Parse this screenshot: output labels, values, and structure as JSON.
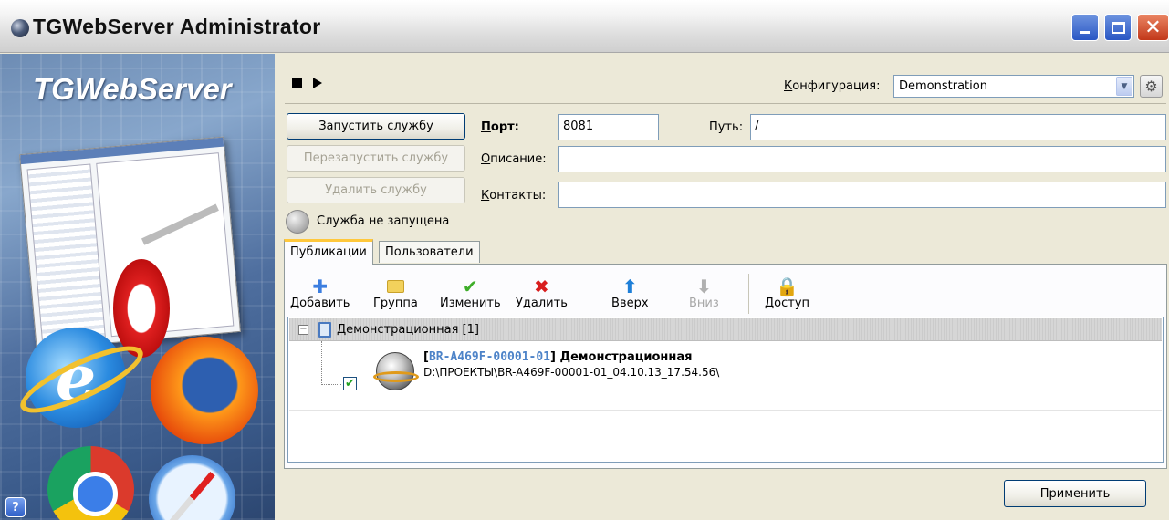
{
  "window": {
    "title": "TGWebServer Administrator"
  },
  "sidebar": {
    "brand": "TGWebServer",
    "help": "?"
  },
  "toolbar_top": {
    "config_label": "Конфигурация:",
    "config_value": "Demonstration"
  },
  "service": {
    "start_label": "Запустить службу",
    "restart_label": "Перезапустить службу",
    "delete_label": "Удалить службу",
    "status_text": "Служба не запущена"
  },
  "settings": {
    "port_label": "Порт:",
    "port_value": "8081",
    "path_label": "Путь:",
    "path_value": "/",
    "description_label": "Описание:",
    "description_value": "",
    "contacts_label": "Контакты:",
    "contacts_value": ""
  },
  "tabs": [
    {
      "label": "Публикации",
      "active": true
    },
    {
      "label": "Пользователи",
      "active": false
    }
  ],
  "pub_toolbar": {
    "add": "Добавить",
    "group": "Группа",
    "edit": "Изменить",
    "delete": "Удалить",
    "up": "Вверх",
    "down": "Вниз",
    "access": "Доступ"
  },
  "tree": {
    "group_label": "Демонстрационная [1]",
    "items": [
      {
        "bracket_open": "[",
        "code": "BR-A469F-00001-01",
        "bracket_close": "]",
        "name": " Демонстрационная",
        "path": "D:\\ПРОЕКТЫ\\BR-A469F-00001-01_04.10.13_17.54.56\\",
        "checked": true
      }
    ]
  },
  "apply_label": "Применить",
  "colors": {
    "title_close": "#c2381a",
    "tab_highlight": "#ffc83c",
    "link_code": "#4d83c8"
  }
}
